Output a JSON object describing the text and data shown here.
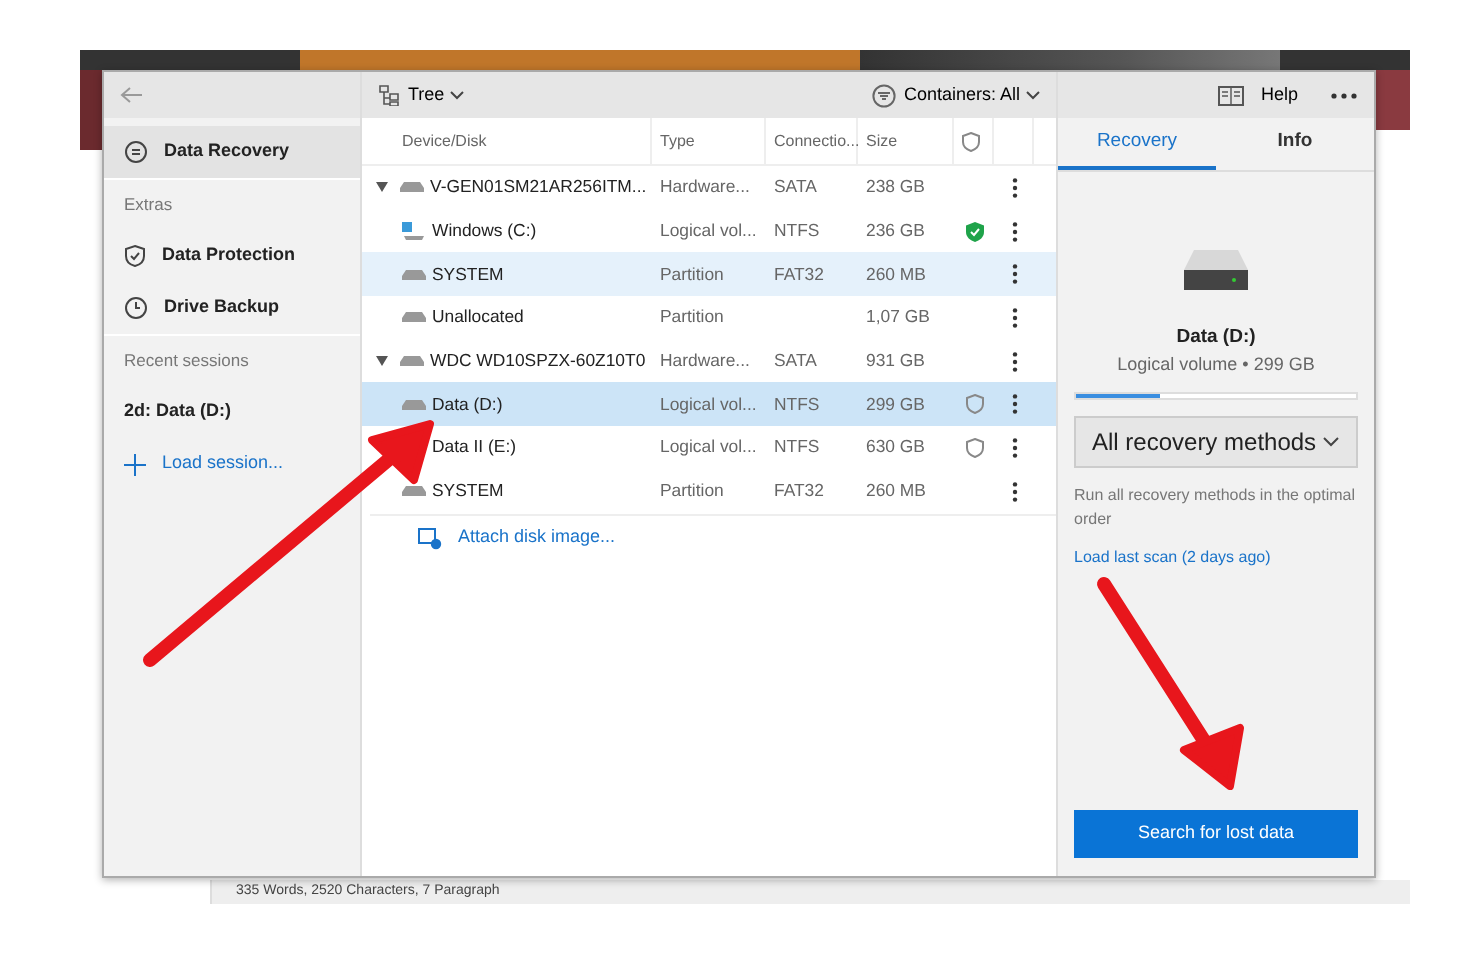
{
  "background_app": {
    "status_bar": "335 Words, 2520 Characters, 7 Paragraph"
  },
  "toolbar": {
    "view": "Tree",
    "filter": "Containers: All",
    "help": "Help"
  },
  "sidebar": {
    "items": [
      {
        "kind": "item",
        "label": "Data Recovery",
        "selected": true
      },
      {
        "kind": "heading",
        "label": "Extras"
      },
      {
        "kind": "item",
        "label": "Data Protection",
        "selected": false
      },
      {
        "kind": "item",
        "label": "Drive Backup",
        "selected": false
      },
      {
        "kind": "heading",
        "label": "Recent sessions"
      },
      {
        "kind": "session",
        "label": "2d: Data (D:)",
        "selected": false
      },
      {
        "kind": "link",
        "label": "Load session...",
        "selected": false
      }
    ]
  },
  "table": {
    "columns": [
      "Device/Disk",
      "Type",
      "Connectio...",
      "Size"
    ],
    "rows": [
      {
        "kind": "drive",
        "name": "V-GEN01SM21AR256ITM...",
        "type": "Hardware...",
        "connection": "SATA",
        "size": "238 GB",
        "expanded": true,
        "selected": false,
        "hovered": false,
        "children": [
          {
            "kind": "system",
            "name": "Windows (C:)",
            "type": "Logical vol...",
            "connection": "NTFS",
            "size": "236 GB",
            "protected": true,
            "selected": false,
            "hovered": false
          },
          {
            "kind": "drive",
            "name": "SYSTEM",
            "type": "Partition",
            "connection": "FAT32",
            "size": "260 MB",
            "selected": false,
            "hovered": true
          },
          {
            "kind": "drive",
            "name": "Unallocated",
            "type": "Partition",
            "size": "1,07 GB",
            "selected": false,
            "hovered": false
          }
        ]
      },
      {
        "kind": "drive",
        "name": "WDC WD10SPZX-60Z10T0",
        "type": "Hardware...",
        "connection": "SATA",
        "size": "931 GB",
        "expanded": true,
        "selected": false,
        "hovered": false,
        "children": [
          {
            "kind": "drive",
            "name": "Data (D:)",
            "type": "Logical vol...",
            "connection": "NTFS",
            "size": "299 GB",
            "protected": false,
            "selected": true,
            "hovered": false
          },
          {
            "kind": "drive",
            "name": "Data II (E:)",
            "type": "Logical vol...",
            "connection": "NTFS",
            "size": "630 GB",
            "protected": false,
            "selected": false,
            "hovered": false
          },
          {
            "kind": "drive",
            "name": "SYSTEM",
            "type": "Partition",
            "connection": "FAT32",
            "size": "260 MB",
            "selected": false,
            "hovered": false
          }
        ]
      }
    ],
    "attach": "Attach disk image..."
  },
  "panel": {
    "tabs": [
      {
        "label": "Recovery",
        "selected": true
      },
      {
        "label": "Info",
        "selected": false
      }
    ],
    "drive_name": "Data (D:)",
    "drive_detail": "Logical volume • 299 GB",
    "level": 0.3,
    "method": "All recovery methods",
    "description": "Run all recovery methods in the optimal order",
    "last_scan": "Load last scan (2 days ago)",
    "button": "Search for lost data"
  }
}
